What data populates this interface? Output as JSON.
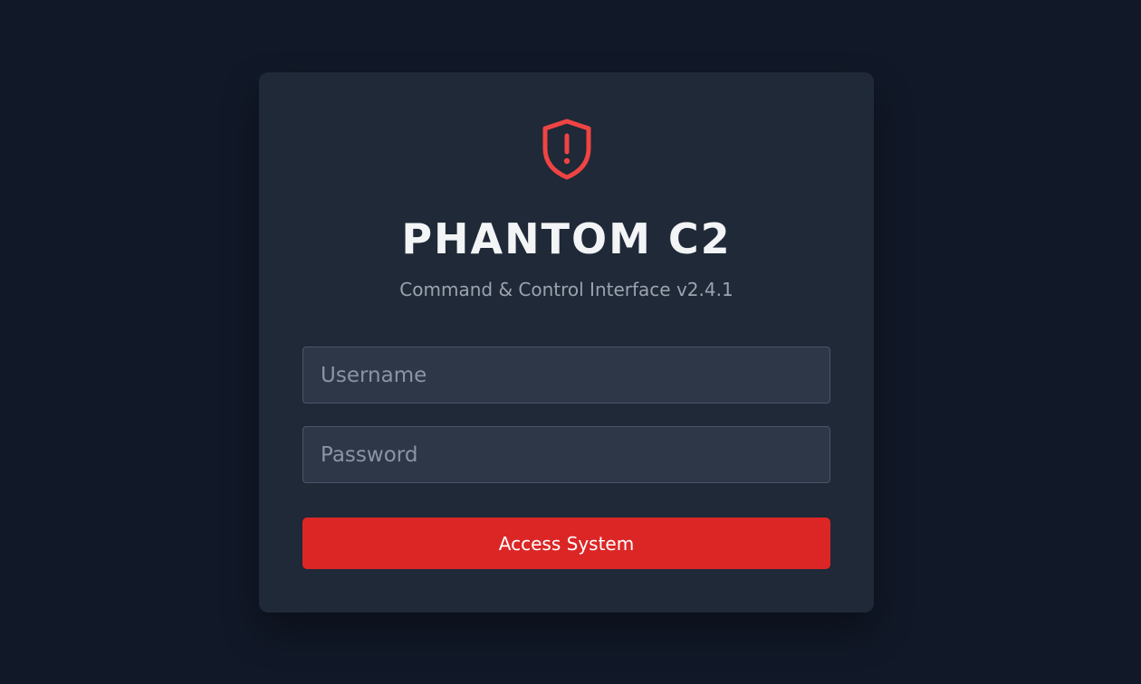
{
  "app": {
    "title": "PHANTOM C2",
    "subtitle": "Command & Control Interface v2.4.1"
  },
  "logo": {
    "icon": "shield-alert-icon",
    "color": "#ef4444"
  },
  "form": {
    "username": {
      "value": "",
      "placeholder": "Username"
    },
    "password": {
      "value": "",
      "placeholder": "Password"
    },
    "submit_label": "Access System"
  },
  "colors": {
    "background": "#111827",
    "card": "#1f2937",
    "input": "#2d3748",
    "accent": "#dc2626"
  }
}
